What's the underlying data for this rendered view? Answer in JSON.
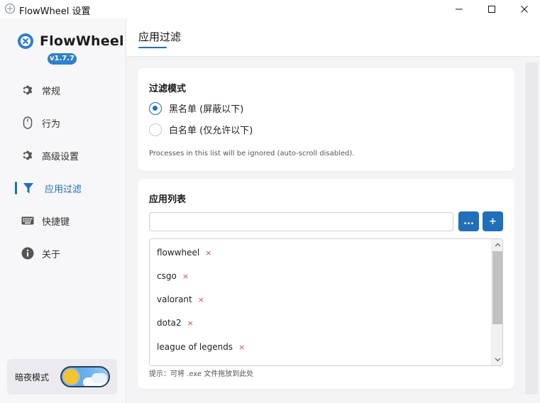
{
  "window": {
    "title": "FlowWheel 设置",
    "minimize": "—",
    "maximize": "☐",
    "close": "✕"
  },
  "sidebar": {
    "brand_name": "FlowWheel",
    "version": "v1.7.7",
    "items": [
      {
        "label": "常规",
        "icon": "gear-icon"
      },
      {
        "label": "行为",
        "icon": "mouse-icon"
      },
      {
        "label": "高级设置",
        "icon": "gear-icon"
      },
      {
        "label": "应用过滤",
        "icon": "filter-icon",
        "active": true
      },
      {
        "label": "快捷键",
        "icon": "keyboard-icon"
      },
      {
        "label": "关于",
        "icon": "info-icon"
      }
    ],
    "theme_label": "暗夜模式"
  },
  "page": {
    "title": "应用过滤"
  },
  "filter_mode": {
    "title": "过滤模式",
    "options": [
      {
        "label": "黑名单 (屏蔽以下)",
        "checked": true
      },
      {
        "label": "白名单 (仅允许以下)",
        "checked": false
      }
    ],
    "hint": "Processes in this list will be ignored (auto-scroll disabled)."
  },
  "app_list": {
    "title": "应用列表",
    "input_value": "",
    "more_label": "...",
    "add_label": "+",
    "items": [
      "flowwheel",
      "csgo",
      "valorant",
      "dota2",
      "league of legends"
    ],
    "remove_glyph": "×",
    "drop_hint": "提示：可将 .exe 文件拖放到此处"
  },
  "colors": {
    "accent": "#1f6fbd",
    "remove": "#e04a4a"
  }
}
